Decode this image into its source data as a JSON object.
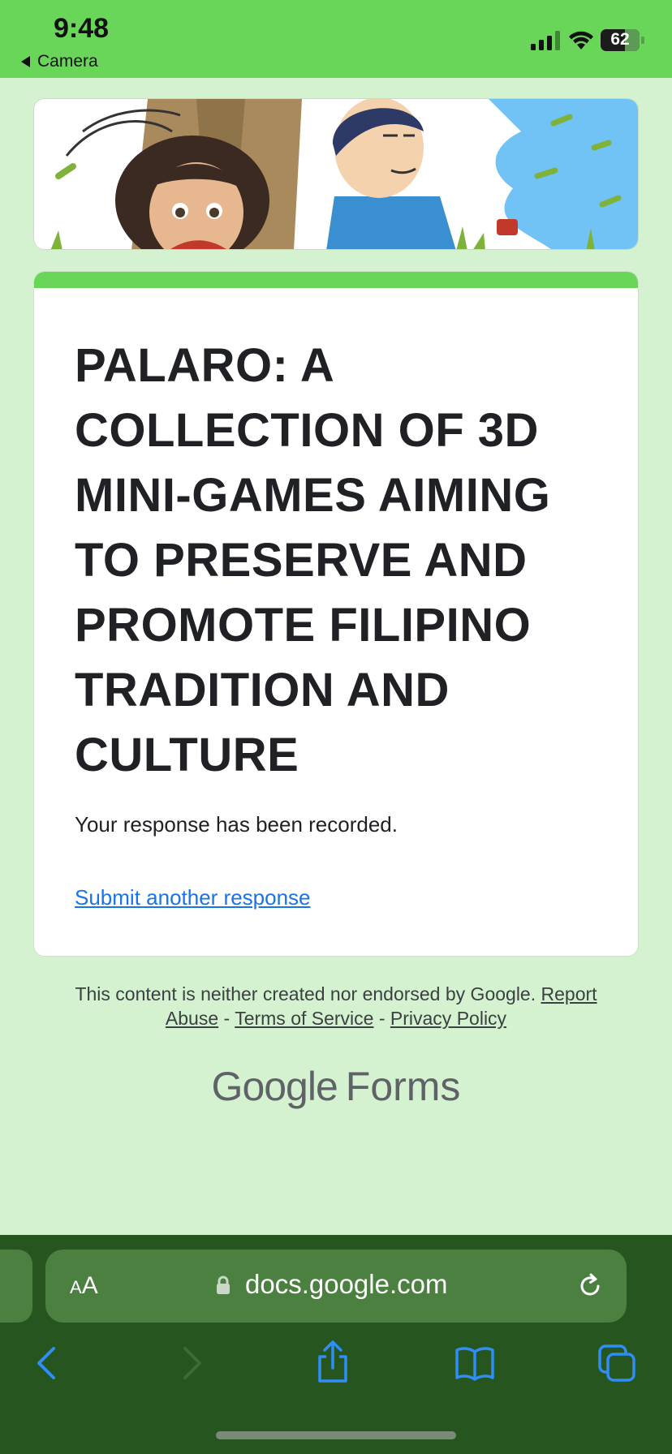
{
  "status_bar": {
    "time": "9:48",
    "back_app": "Camera",
    "battery_level": "62",
    "battery_fraction": 0.62
  },
  "form": {
    "title": "PALARO: A COLLECTION OF 3D MINI-GAMES AIMING TO PRESERVE AND PROMOTE FILIPINO TRADITION AND CULTURE",
    "confirmation": "Your response has been recorded.",
    "submit_another": "Submit another response",
    "accent_color": "#69d559"
  },
  "footer": {
    "disclaimer_text": "This content is neither created nor endorsed by Google.",
    "report_abuse": "Report Abuse",
    "separator": "-",
    "terms": "Terms of Service",
    "privacy": "Privacy Policy",
    "brand_google": "Google",
    "brand_forms": "Forms"
  },
  "browser": {
    "text_size_button": "AA",
    "url": "docs.google.com",
    "icons": [
      "lock-icon",
      "reload-icon",
      "back-arrow-icon",
      "forward-arrow-icon",
      "share-icon",
      "bookmarks-icon",
      "tabs-icon"
    ]
  }
}
